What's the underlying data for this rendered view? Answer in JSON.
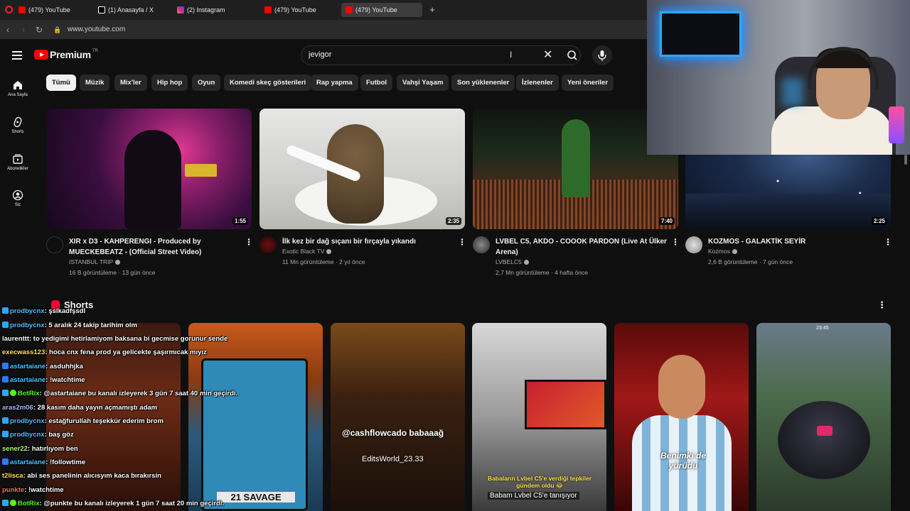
{
  "browser": {
    "tabs": [
      {
        "label": "(479) YouTube",
        "fav": "#ff0000",
        "active": false
      },
      {
        "label": "(1) Anasayfa / X",
        "fav": "#ffffff",
        "active": false
      },
      {
        "label": "(2) Instagram",
        "fav": "#d6249f",
        "active": false
      },
      {
        "label": "(479) YouTube",
        "fav": "#ff0000",
        "active": false
      },
      {
        "label": "(479) YouTube",
        "fav": "#ff0000",
        "active": true
      }
    ],
    "url": "www.youtube.com"
  },
  "header": {
    "logo_text": "Premium",
    "logo_region": "TR",
    "search_value": "jevigor"
  },
  "sidebar": [
    {
      "label": "Ana Sayfa",
      "icon": "home-icon"
    },
    {
      "label": "Shorts",
      "icon": "shorts-icon"
    },
    {
      "label": "Abonelikler",
      "icon": "subscriptions-icon"
    },
    {
      "label": "Siz",
      "icon": "you-icon"
    }
  ],
  "chips": [
    "Tümü",
    "Müzik",
    "Mix'ler",
    "Hip hop",
    "Oyun",
    "Komedi skeç gösterileri",
    "Rap yapma",
    "Futbol",
    "Vahşi Yaşam",
    "Son yüklenenler",
    "İzlenenler",
    "Yeni öneriler"
  ],
  "videos": [
    {
      "title": "XIR x D3 - KAHPERENGI - Produced by MUECKEBEATZ - (Official Street Video)",
      "channel": "ISTANBUL TRIP",
      "meta": "16 B görüntüleme · 13 gün önce",
      "duration": "1:55"
    },
    {
      "title": "İlk kez bir dağ sıçanı bir fırçayla yıkandı",
      "channel": "Exotic Black TV",
      "meta": "11 Mn görüntüleme · 2 yıl önce",
      "duration": "2:35"
    },
    {
      "title": "LVBEL C5, AKDO - COOOK PARDON (Live At Ülker Arena)",
      "channel": "LVBELC5",
      "meta": "2,7 Mn görüntüleme · 4 hafta önce",
      "duration": "7:40"
    },
    {
      "title": "KOZMOS - GALAKTİK SEYİR",
      "channel": "Kozmos",
      "meta": "2,6 B görüntüleme · 7 gün önce",
      "duration": "2:25"
    }
  ],
  "shorts": {
    "title": "Shorts",
    "items": [
      {
        "caption": ""
      },
      {
        "caption": "21 SAVAGE"
      },
      {
        "caption": "@cashflowcado babaaağ",
        "sub": "EditsWorld_23.33"
      },
      {
        "caption": "Babaların Lvbel C5'e verdiği tepkiler gündem oldu 😂",
        "sub": "Babam Lvbel C5'e tanışıyor"
      },
      {
        "caption": "Benimki de yürüdü"
      },
      {
        "caption": "23:45"
      }
    ]
  },
  "chat": [
    {
      "user": "prodbycnx",
      "text": ": şslkadfşsdl",
      "color": "#4fc3ff"
    },
    {
      "user": "prodbycnx",
      "text": ": 5 aralık 24 takip tarihim olm",
      "color": "#4fc3ff"
    },
    {
      "user": "laurenttt",
      "text": ": to yedigimi hetirlamiyom baksana bi gecmise gorunur sende",
      "color": "#ffffff"
    },
    {
      "user": "execwass123",
      "text": ": hoca cnx fena prod ya gelicekte şaşırmıcak mıyız",
      "color": "#ffe34f"
    },
    {
      "user": "astartaiane",
      "text": ": asduhhjka",
      "color": "#4fc3ff"
    },
    {
      "user": "astartaiane",
      "text": ": !watchtime",
      "color": "#4fc3ff"
    },
    {
      "user": "BotRix",
      "text": ": @astartaiane bu kanalı izleyerek 3 gün 7 saat 40 min geçirdi.",
      "color": "#53fc18"
    },
    {
      "user": "aras2m06",
      "text": ": 28 kasım daha yayın açmamıştı adam",
      "color": "#b0b0ff"
    },
    {
      "user": "prodbycnx",
      "text": ": estağfurullah teşekkür ederim brom",
      "color": "#4fc3ff"
    },
    {
      "user": "prodbycnx",
      "text": ": baş göz",
      "color": "#4fc3ff"
    },
    {
      "user": "sener22",
      "text": ": hatırlıyom ben",
      "color": "#a8ff6e"
    },
    {
      "user": "astartaiane",
      "text": ": !followtime",
      "color": "#4fc3ff"
    },
    {
      "user": "t2lisca",
      "text": ": abi ses panelinin alıcısyım kaca bırakırsin",
      "color": "#ffe34f"
    },
    {
      "user": "punkte",
      "text": ": !watchtime",
      "color": "#ff6a6a"
    },
    {
      "user": "BotRix",
      "text": ": @punkte bu kanalı izleyerek 1 gün 7 saat 20 min geçirdi.",
      "color": "#53fc18"
    }
  ]
}
